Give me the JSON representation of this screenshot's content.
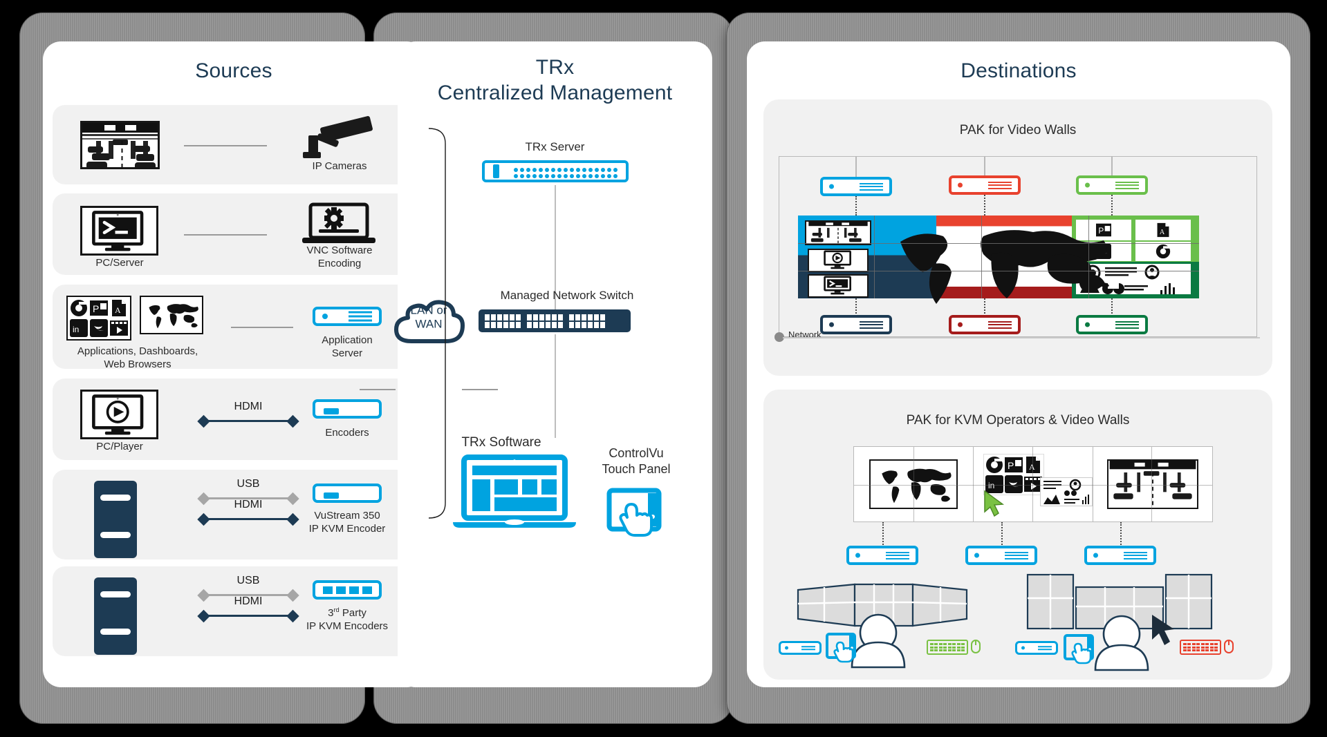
{
  "columns": {
    "sources": {
      "title": "Sources"
    },
    "center": {
      "title_line1": "TRx",
      "title_line2": "Centralized Management"
    },
    "destinations": {
      "title": "Destinations"
    }
  },
  "sources": {
    "rows": [
      {
        "source_label": "",
        "source_icon": "traffic-camera-view-icon",
        "link_label": "",
        "link_type": "plain",
        "target_label": "IP Cameras",
        "target_icon": "ip-camera-icon"
      },
      {
        "source_label": "PC/Server",
        "source_icon": "terminal-monitor-icon",
        "link_label": "",
        "link_type": "plain",
        "target_label": "VNC Software\nEncoding",
        "target_label_line1": "VNC Software",
        "target_label_line2": "Encoding",
        "target_icon": "laptop-gear-icon"
      },
      {
        "source_label": "Applications, Dashboards,\nWeb Browsers",
        "source_label_line1": "Applications, Dashboards,",
        "source_label_line2": "Web Browsers",
        "source_icon": "app-tiles-and-map-icon",
        "link_label": "",
        "link_type": "plain",
        "target_label_line1": "Application",
        "target_label_line2": "Server",
        "target_icon": "application-server-icon"
      },
      {
        "source_label": "PC/Player",
        "source_icon": "media-player-monitor-icon",
        "link_label": "HDMI",
        "link_type": "navy",
        "target_label_line1": "Encoders",
        "target_label_line2": "",
        "target_icon": "encoder-appliance-icon"
      },
      {
        "source_label": "",
        "source_icon": "tower-pc-icon",
        "link_label": "USB",
        "link_label2": "HDMI",
        "link_type": "dual",
        "target_label_line1": "VuStream 350",
        "target_label_line2": "IP KVM Encoder",
        "target_icon": "encoder-appliance-icon"
      },
      {
        "source_label": "",
        "source_icon": "tower-pc-icon",
        "link_label": "USB",
        "link_label2": "HDMI",
        "link_type": "dual",
        "target_label_line1": "3rd Party",
        "target_label_sup": "rd",
        "target_label_line2": "IP KVM Encoders",
        "target_icon": "multiport-encoder-icon"
      }
    ]
  },
  "center": {
    "trx_server_label": "TRx Server",
    "cloud_label_line1": "LAN or",
    "cloud_label_line2": "WAN",
    "switch_label": "Managed Network Switch",
    "trx_software_label": "TRx Software",
    "touch_panel_label_line1": "ControlVu",
    "touch_panel_label_line2": "Touch Panel"
  },
  "destinations": {
    "panel1": {
      "title": "PAK for Video Walls",
      "network_label": "Network",
      "top_receivers": [
        "cyan",
        "red",
        "green"
      ],
      "bottom_receivers": [
        "navy",
        "darkred",
        "darkgreen"
      ],
      "wall_tiles": [
        "traffic-camera-view-icon",
        "media-player-monitor-icon",
        "terminal-monitor-icon",
        "world-map-icon",
        "powerpoint-icon",
        "pdf-icon",
        "twitter-icon",
        "chrome-icon",
        "dashboard-charts-icon"
      ]
    },
    "panel2": {
      "title": "PAK for KVM Operators & Video Walls",
      "receivers": [
        "cyan",
        "cyan",
        "cyan"
      ],
      "wall_tiles": [
        "world-map-icon",
        "app-tiles-icon",
        "traffic-camera-view-icon"
      ],
      "operators": [
        {
          "monitors": 3,
          "receiver": "cyan",
          "touch": "cyan",
          "keyboard": "green"
        },
        {
          "monitors": 4,
          "receiver": "cyan",
          "touch": "cyan",
          "keyboard": "red"
        }
      ]
    }
  },
  "colors": {
    "cyan": "#00a3e0",
    "navy": "#1d3b54",
    "red": "#e8422e",
    "dark_red": "#a51c1c",
    "green": "#6abf4b",
    "dark_green": "#0a7a42",
    "grey_panel": "#f1f1f1",
    "shell_grey": "#949494",
    "line_grey": "#9a9a9a"
  }
}
